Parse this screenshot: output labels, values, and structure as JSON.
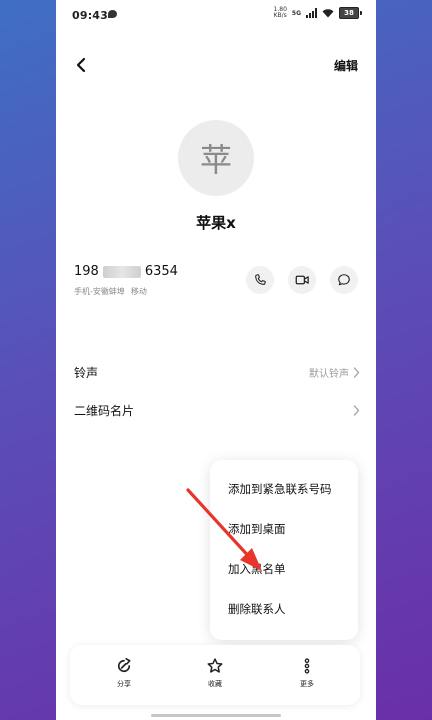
{
  "status_bar": {
    "time": "09:43",
    "net_speed_top": "1.80",
    "net_speed_bottom": "KB/s",
    "network": "5G",
    "battery": "38"
  },
  "header": {
    "edit_label": "编辑"
  },
  "contact": {
    "avatar_char": "苹",
    "name": "苹果x",
    "phone_prefix": "198",
    "phone_suffix": "6354",
    "phone_type": "手机-安徽蚌埠",
    "carrier": "移动"
  },
  "settings": [
    {
      "label": "铃声",
      "value": "默认铃声"
    },
    {
      "label": "二维码名片",
      "value": ""
    }
  ],
  "popup_menu": {
    "items": [
      "添加到紧急联系号码",
      "添加到桌面",
      "加入黑名单",
      "删除联系人"
    ]
  },
  "bottom_bar": {
    "share_label": "分享",
    "favorite_label": "收藏",
    "more_label": "更多"
  },
  "colors": {
    "annotation_arrow": "#e8352c"
  }
}
